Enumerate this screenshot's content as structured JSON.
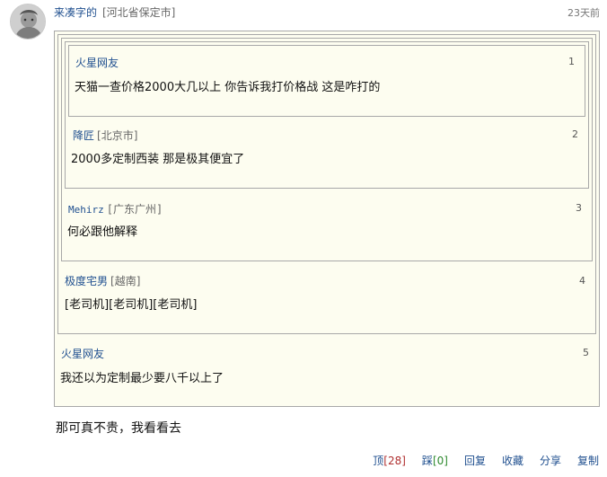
{
  "comment": {
    "username": "来凑字的",
    "location": "[河北省保定市]",
    "time": "23天前",
    "reply_text": "那可真不贵，我看看去"
  },
  "quotes": [
    {
      "floor": "1",
      "name": "火星网友",
      "location": "",
      "text": "天猫一查价格2000大几以上 你告诉我打价格战 这是咋打的"
    },
    {
      "floor": "2",
      "name": "降匠",
      "location": "[北京市]",
      "text": "2000多定制西装 那是极其便宜了"
    },
    {
      "floor": "3",
      "name": "Mehirz",
      "location": "[广东广州]",
      "text": "何必跟他解释"
    },
    {
      "floor": "4",
      "name": "极度宅男",
      "location": "[越南]",
      "text": "[老司机][老司机][老司机]"
    },
    {
      "floor": "5",
      "name": "火星网友",
      "location": "",
      "text": "我还以为定制最少要八千以上了"
    }
  ],
  "actions": {
    "up_label": "顶",
    "up_count": "[28]",
    "down_label": "踩",
    "down_count": "[0]",
    "reply_label": "回复",
    "fav_label": "收藏",
    "share_label": "分享",
    "copy_label": "复制"
  }
}
